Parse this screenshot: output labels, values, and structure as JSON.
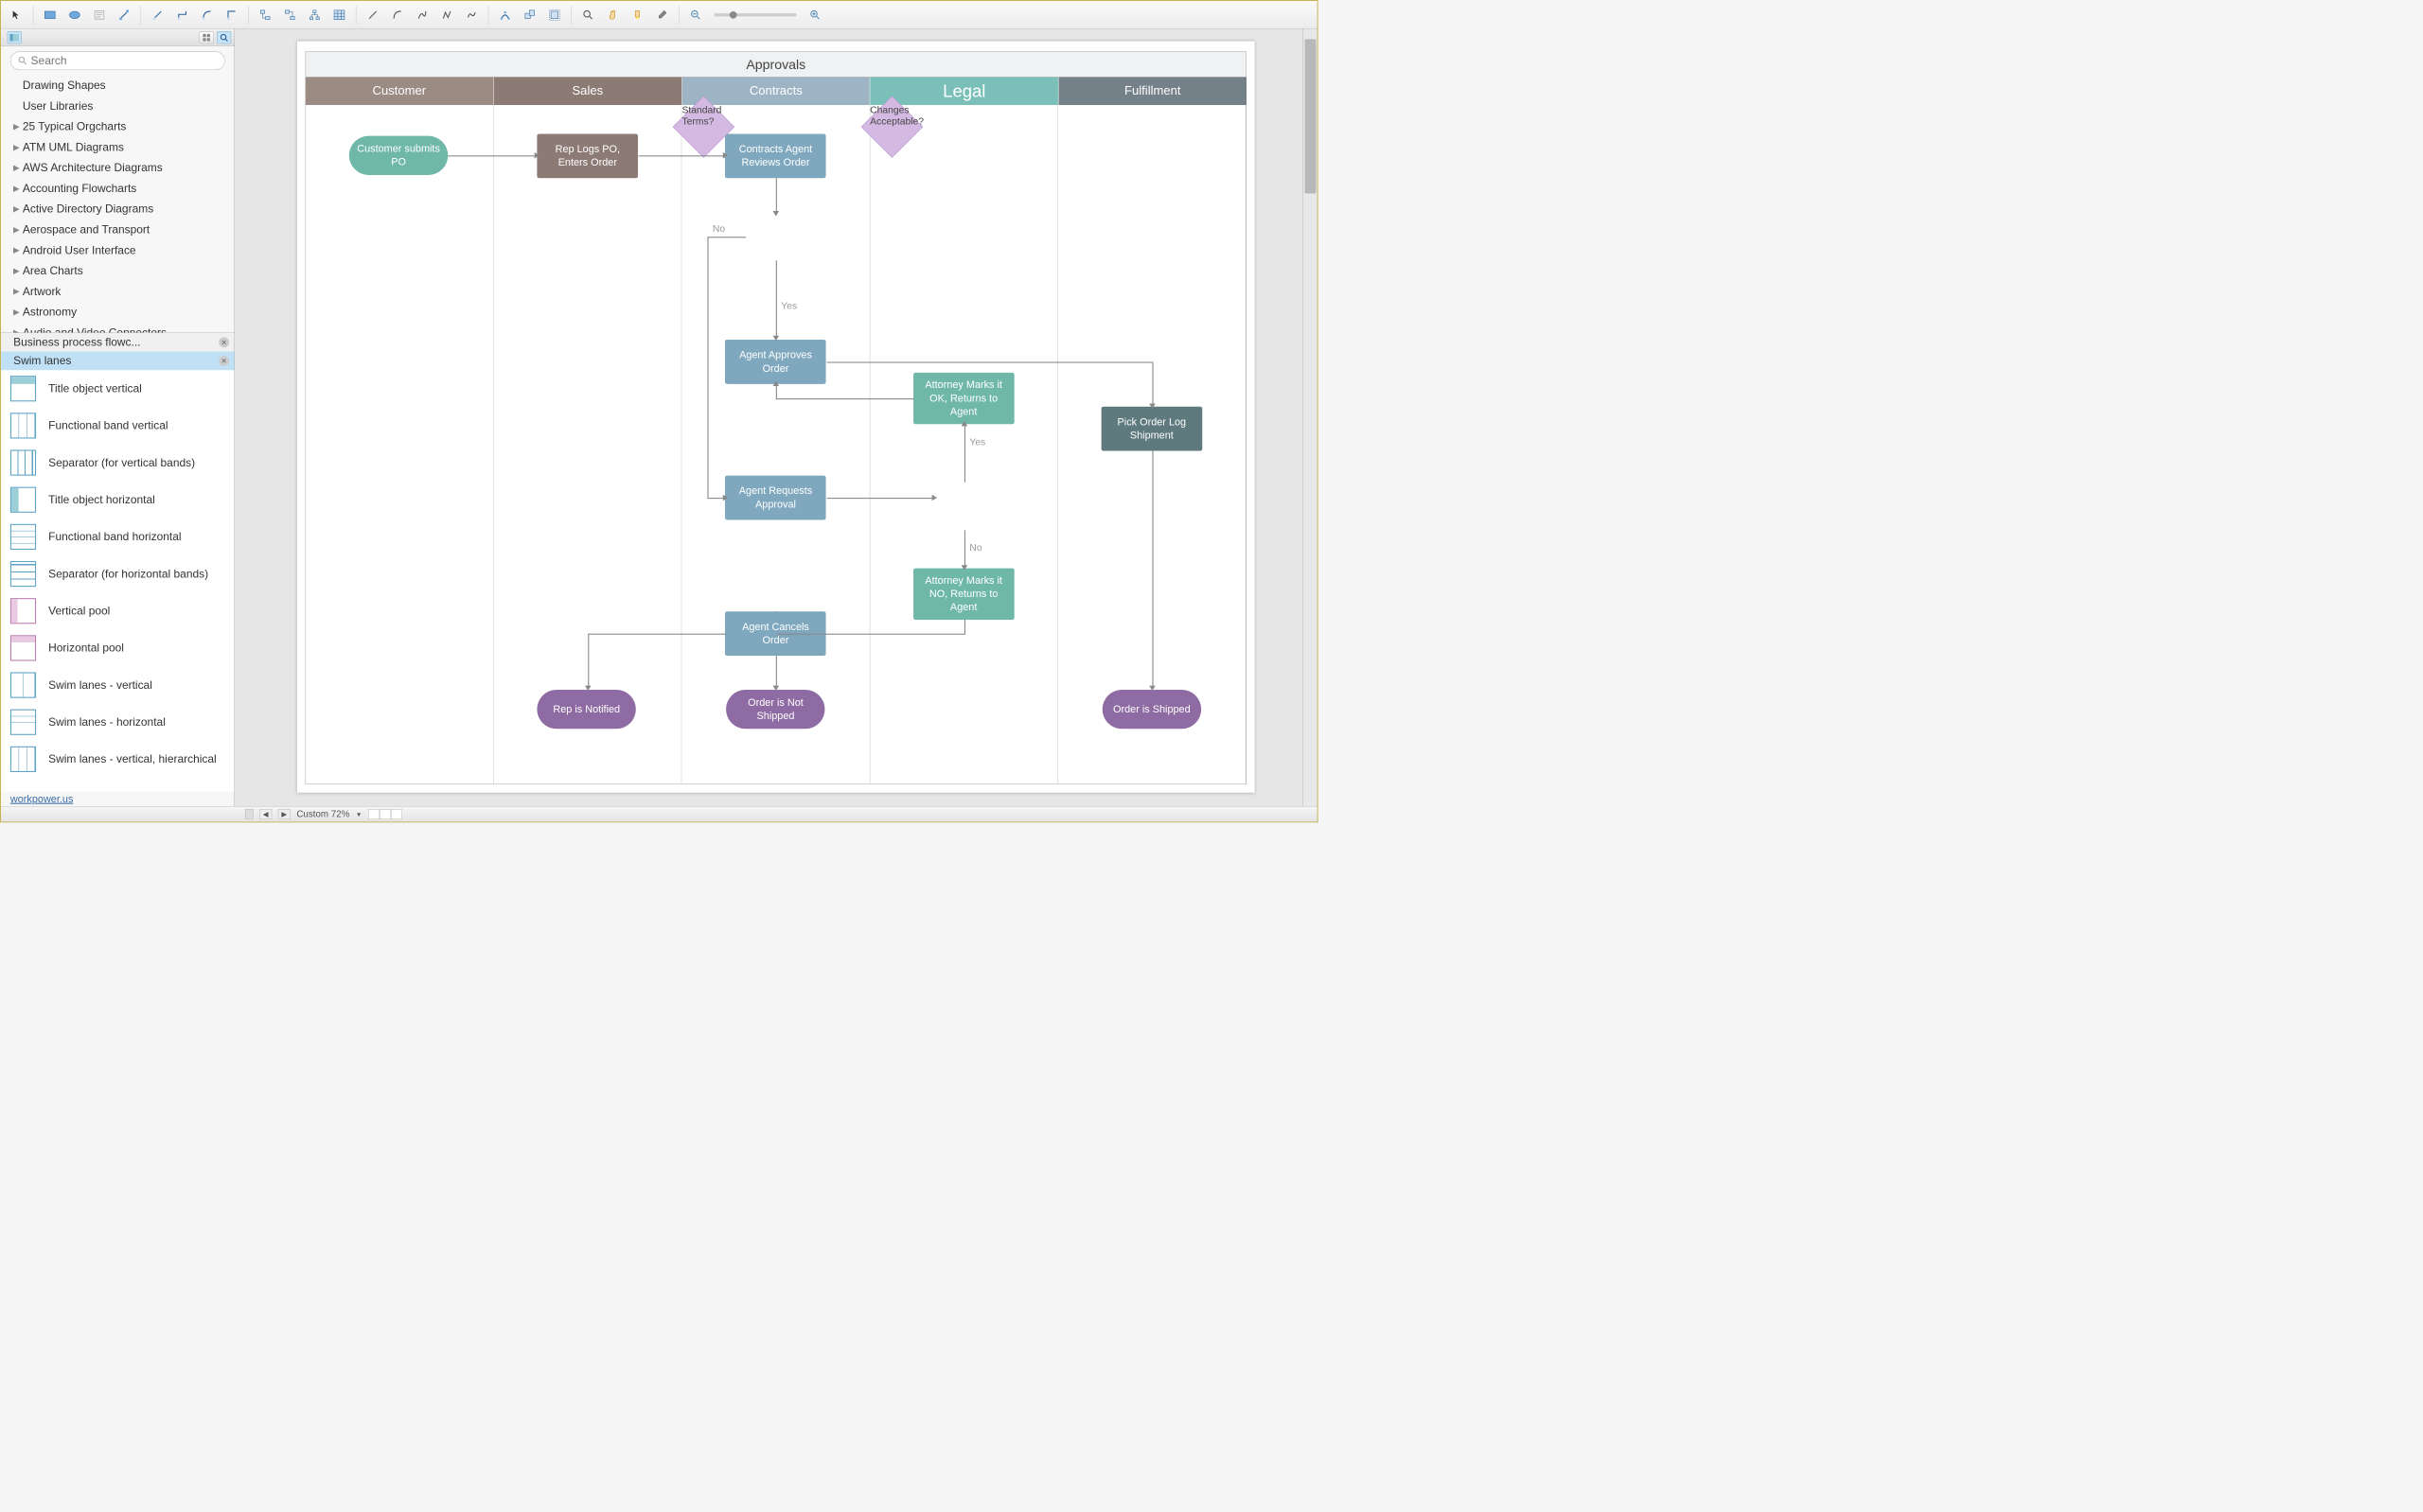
{
  "toolbar_icons": [
    "cursor",
    "rect",
    "ellipse",
    "text",
    "connector",
    "l-conn",
    "curve-conn",
    "step-conn",
    "smart-conn",
    "route-conn",
    "tree-conn",
    "table",
    "line",
    "arc",
    "curve",
    "poly",
    "free",
    "group",
    "ungroup",
    "align",
    "zoom-area",
    "pan",
    "highlighter",
    "eyedropper"
  ],
  "search": {
    "placeholder": "Search"
  },
  "sidebar_top": [
    "Drawing Shapes",
    "User Libraries"
  ],
  "sidebar_tree": [
    "25 Typical Orgcharts",
    "ATM UML Diagrams",
    "AWS Architecture Diagrams",
    "Accounting Flowcharts",
    "Active Directory Diagrams",
    "Aerospace and Transport",
    "Android User Interface",
    "Area Charts",
    "Artwork",
    "Astronomy",
    "Audio and Video Connectors"
  ],
  "lib_tabs": [
    {
      "label": "Business process flowc...",
      "active": false
    },
    {
      "label": "Swim lanes",
      "active": true
    }
  ],
  "shapes": [
    {
      "label": "Title object vertical",
      "thumb": "t1"
    },
    {
      "label": "Functional band vertical",
      "thumb": "t2"
    },
    {
      "label": "Separator (for vertical bands)",
      "thumb": "t3"
    },
    {
      "label": "Title object horizontal",
      "thumb": "t4"
    },
    {
      "label": "Functional band horizontal",
      "thumb": "t5"
    },
    {
      "label": "Separator (for horizontal bands)",
      "thumb": "t6"
    },
    {
      "label": "Vertical pool",
      "thumb": "t7"
    },
    {
      "label": "Horizontal pool",
      "thumb": "t8"
    },
    {
      "label": "Swim lanes - vertical",
      "thumb": "t2"
    },
    {
      "label": "Swim lanes - horizontal",
      "thumb": "t5"
    },
    {
      "label": "Swim lanes - vertical, hierarchical",
      "thumb": "t2"
    }
  ],
  "sidebar_footer": "workpower.us",
  "diagram": {
    "title": "Approvals",
    "lanes": [
      {
        "label": "Customer",
        "color": "#9a8b83"
      },
      {
        "label": "Sales",
        "color": "#8c7a75"
      },
      {
        "label": "Contracts",
        "color": "#9db4c4"
      },
      {
        "label": "Legal",
        "color": "#7ac0b8",
        "big": true
      },
      {
        "label": "Fulfillment",
        "color": "#748189"
      }
    ],
    "nodes": {
      "customer_po": "Customer submits PO",
      "rep_logs": "Rep Logs PO, Enters Order",
      "reviews": "Contracts Agent Reviews Order",
      "std_terms": "Standard Terms?",
      "approves": "Agent Approves Order",
      "requests": "Agent Requests Approval",
      "cancels": "Agent Cancels Order",
      "attorney_ok": "Attorney Marks it OK, Returns to Agent",
      "changes": "Changes Acceptable?",
      "attorney_no": "Attorney Marks it NO, Returns to Agent",
      "pick": "Pick Order Log Shipment",
      "rep_notified": "Rep is Notified",
      "not_shipped": "Order is Not Shipped",
      "shipped": "Order is Shipped"
    },
    "edge_labels": {
      "no": "No",
      "yes": "Yes"
    }
  },
  "status": {
    "nav_back": "◀",
    "nav_fwd": "▶",
    "zoom": "Custom 72%"
  }
}
